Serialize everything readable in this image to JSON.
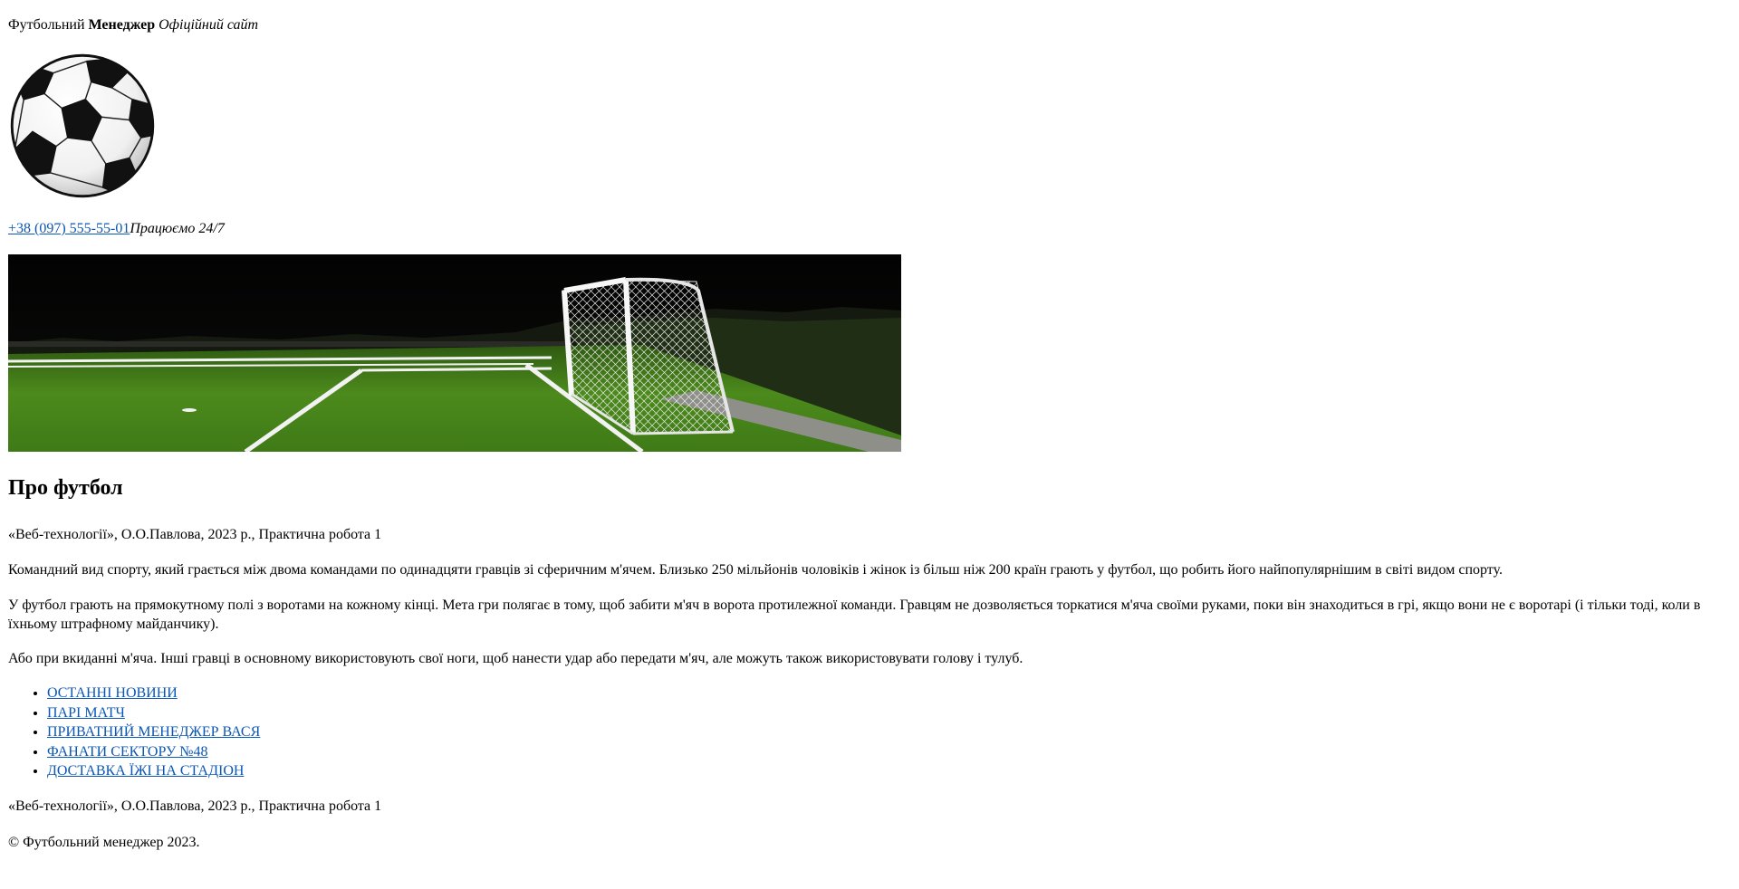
{
  "header": {
    "title_part1": "Футбольний ",
    "title_bold": "Менеджер",
    "title_italic": "Офіційний сайт"
  },
  "logo": {
    "icon": "soccer-ball-icon"
  },
  "contact": {
    "phone": "+38 (097) 555-55-01",
    "hours": "Працюємо 24/7"
  },
  "banner": {
    "icon": "football-goal-field-image"
  },
  "main": {
    "heading": "Про футбол",
    "credit": "«Веб-технології», О.О.Павлова, 2023 р., Практична робота 1",
    "paragraph1": "Командний вид спорту, який грається між двома командами по одинадцяти гравців зі сферичним м'ячем. Близько 250 мільйонів чоловіків і жінок із більш ніж 200 країн грають у футбол, що робить його найпопулярнішим в світі видом спорту.",
    "paragraph2": "У футбол грають на прямокутному полі з воротами на кожному кінці. Мета гри полягає в тому, щоб забити м'яч в ворота протилежної команди. Гравцям не дозволяється торкатися м'яча своїми руками, поки він знаходиться в грі, якщо вони не є воротарі (і тільки тоді, коли в їхньому штрафному майданчику).",
    "paragraph3": "Або при вкиданні м'яча. Інші гравці в основному використовують свої ноги, щоб нанести удар або передати м'яч, але можуть також використовувати голову і тулуб."
  },
  "nav": {
    "items": [
      {
        "label": "ОСТАННІ НОВИНИ"
      },
      {
        "label": "ПАРІ МАТЧ"
      },
      {
        "label": "ПРИВАТНИЙ МЕНЕДЖЕР ВАСЯ"
      },
      {
        "label": "ФАНАТИ СЕКТОРУ №48"
      },
      {
        "label": "ДОСТАВКА ЇЖІ НА СТАДІОН"
      }
    ]
  },
  "footer": {
    "credit": "«Веб-технології», О.О.Павлова, 2023 р., Практична робота 1",
    "copyright": "© Футбольний менеджер 2023."
  },
  "colors": {
    "link": "#0b57b5",
    "text": "#000000",
    "background": "#ffffff"
  }
}
